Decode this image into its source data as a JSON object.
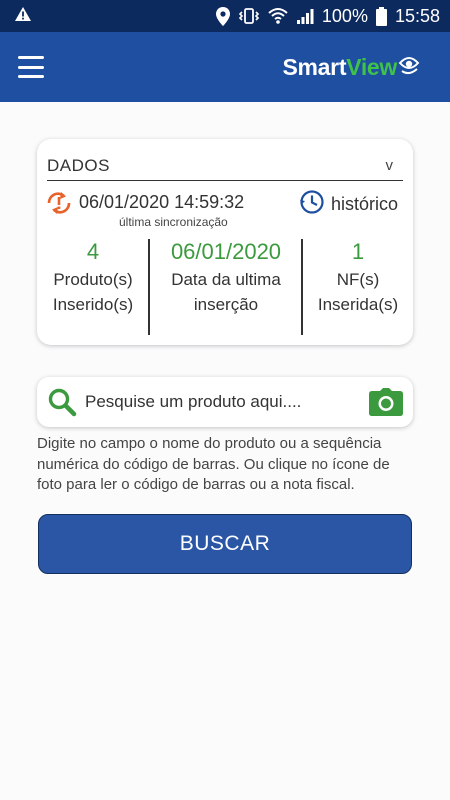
{
  "status_bar": {
    "battery_percent": "100%",
    "time": "15:58",
    "icons": [
      "warning-icon",
      "location-icon",
      "vibrate-icon",
      "wifi-icon",
      "signal-icon",
      "battery-icon"
    ]
  },
  "app_bar": {
    "logo_part1": "Smart",
    "logo_part2": "View",
    "colors": {
      "bar": "#1e4fa0",
      "logo_accent": "#3fc14a"
    }
  },
  "data_card": {
    "title": "DADOS",
    "chevron": "v",
    "sync_datetime": "06/01/2020 14:59:32",
    "sync_caption": "última sincronização",
    "history_label": "histórico",
    "stats": [
      {
        "value": "4",
        "label_line1": "Produto(s)",
        "label_line2": "Inserido(s)"
      },
      {
        "value": "06/01/2020",
        "label_line1": "Data da ultima",
        "label_line2": "inserção"
      },
      {
        "value": "1",
        "label_line1": "NF(s)",
        "label_line2": "Inserida(s)"
      }
    ],
    "colors": {
      "value": "#3c9a3e",
      "sync_icon": "#e8632a",
      "history_icon": "#1e4fa0"
    }
  },
  "search": {
    "placeholder": "Pesquise um produto aqui....",
    "value": "",
    "hint": "Digite no campo o nome do produto ou a sequência numérica do código de barras. Ou clique no ícone de foto para ler o código de barras ou a nota fiscal."
  },
  "button": {
    "label": "BUSCAR"
  }
}
